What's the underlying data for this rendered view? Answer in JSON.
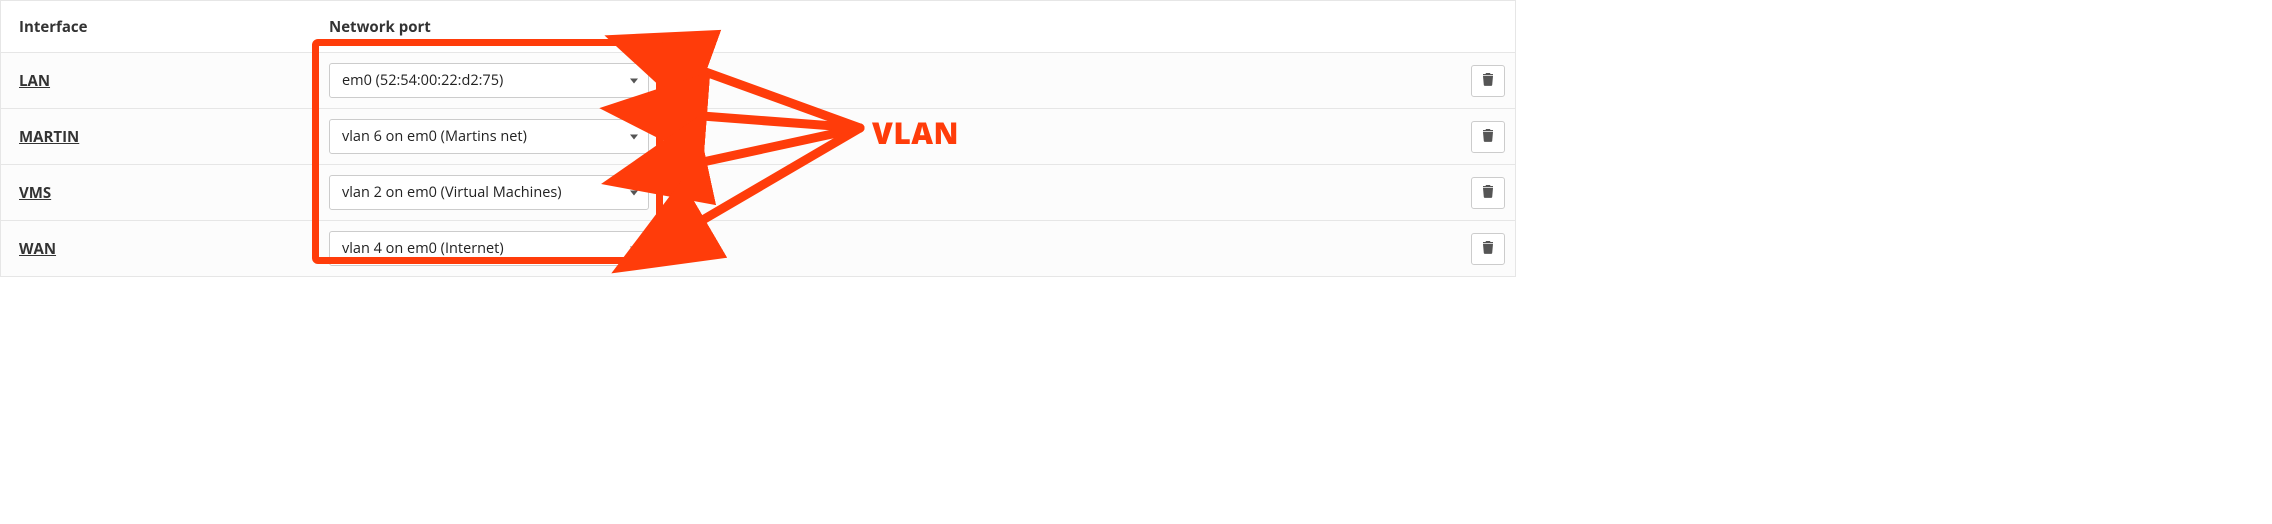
{
  "columns": {
    "iface": "Interface",
    "port": "Network port"
  },
  "rows": [
    {
      "name": "LAN",
      "port": "em0 (52:54:00:22:d2:75)"
    },
    {
      "name": "MARTIN",
      "port": "vlan 6 on em0 (Martins net)"
    },
    {
      "name": "VMS",
      "port": "vlan 2 on em0 (Virtual Machines)"
    },
    {
      "name": "WAN",
      "port": "vlan 4 on em0 (Internet)"
    }
  ],
  "annotation": {
    "label": "VLAN",
    "color": "#ff3c0a"
  }
}
